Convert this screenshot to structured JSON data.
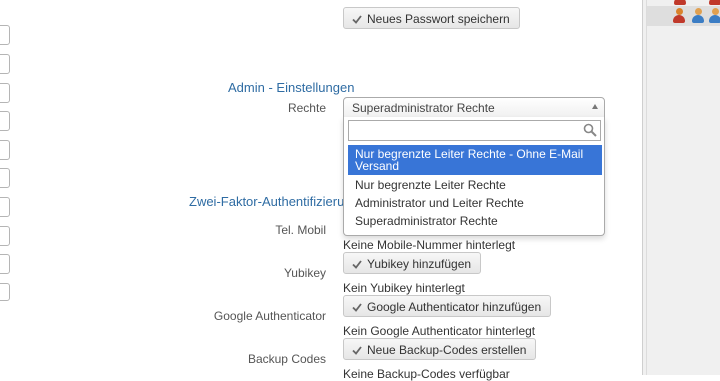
{
  "password": {
    "save_button": "Neues Passwort speichern"
  },
  "admin": {
    "title": "Admin - Einstellungen",
    "rights_label": "Rechte",
    "rights_selected": "Superadministrator Rechte",
    "search_placeholder": "",
    "options": [
      "Nur begrenzte Leiter Rechte - Ohne E-Mail Versand",
      "Nur begrenzte Leiter Rechte",
      "Administrator und Leiter Rechte",
      "Superadministrator Rechte"
    ],
    "highlighted_option": 0
  },
  "two_factor": {
    "title": "Zwei-Faktor-Authentifizierung",
    "mobile_label": "Tel. Mobil",
    "mobile_status": "Keine Mobile-Nummer hinterlegt",
    "yubikey_label": "Yubikey",
    "yubikey_button": "Yubikey hinzufügen",
    "yubikey_status": "Kein Yubikey hinterlegt",
    "google_label": "Google Authenticator",
    "google_button": "Google Authenticator hinzufügen",
    "google_status": "Kein Google Authenticator hinterlegt",
    "backup_label": "Backup Codes",
    "backup_button": "Neue Backup-Codes erstellen",
    "backup_status": "Keine Backup-Codes verfügbar"
  },
  "icons": {
    "check": "check-icon",
    "search": "search-icon",
    "user": "user-icon",
    "dropdown_arrow": "chevron-up-icon"
  },
  "colors": {
    "accent": "#2f6ca3",
    "highlight": "#3875d7",
    "user_red": "#c0392b",
    "user_orange": "#d9822b",
    "user_blue": "#3b7dc4"
  }
}
